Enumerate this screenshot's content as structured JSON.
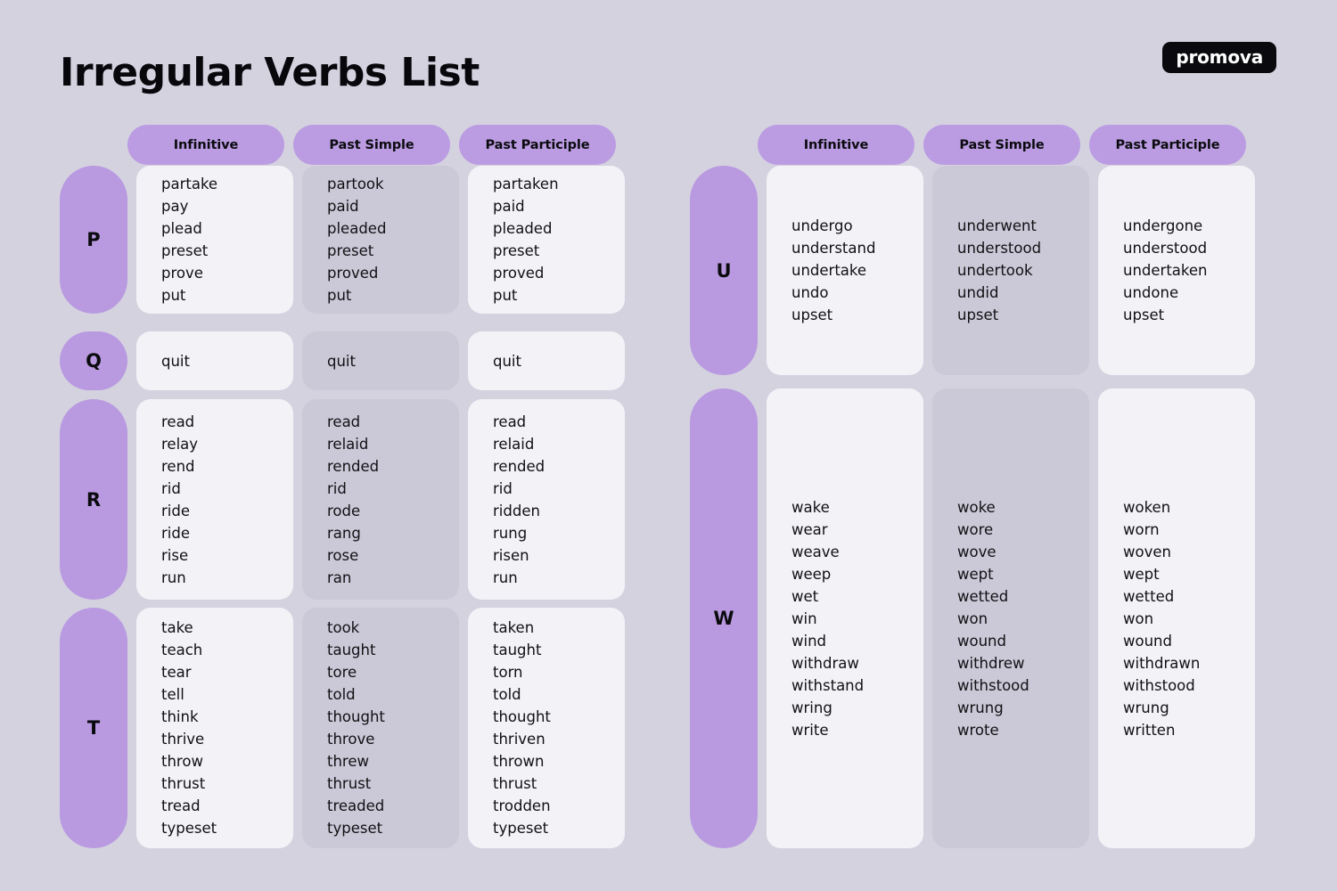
{
  "page": {
    "title": "Irregular Verbs List",
    "brand": "promova",
    "background_color": "#D5D2E0",
    "accent_color": "#BB9CE2",
    "card_light_color": "#F3F2F7",
    "card_shaded_color": "#CBC8D7"
  },
  "columns": {
    "infinitive": "Infinitive",
    "past_simple": "Past Simple",
    "past_participle": "Past Participle"
  },
  "tables": [
    {
      "id": "left",
      "headers": [
        "Infinitive",
        "Past Simple",
        "Past Participle"
      ],
      "groups": [
        {
          "letter": "P",
          "rows": [
            [
              "partake",
              "partook",
              "partaken"
            ],
            [
              "pay",
              "paid",
              "paid"
            ],
            [
              "plead",
              "pleaded",
              "pleaded"
            ],
            [
              "preset",
              "preset",
              "preset"
            ],
            [
              "prove",
              "proved",
              "proved"
            ],
            [
              "put",
              "put",
              "put"
            ]
          ]
        },
        {
          "letter": "Q",
          "rows": [
            [
              "quit",
              "quit",
              "quit"
            ]
          ]
        },
        {
          "letter": "R",
          "rows": [
            [
              "read",
              "read",
              "read"
            ],
            [
              "relay",
              "relaid",
              "relaid"
            ],
            [
              "rend",
              "rended",
              "rended"
            ],
            [
              "rid",
              "rid",
              "rid"
            ],
            [
              "ride",
              "rode",
              "ridden"
            ],
            [
              "ride",
              "rang",
              "rung"
            ],
            [
              "rise",
              "rose",
              "risen"
            ],
            [
              "run",
              "ran",
              "run"
            ]
          ]
        },
        {
          "letter": "T",
          "rows": [
            [
              "take",
              "took",
              "taken"
            ],
            [
              "teach",
              "taught",
              "taught"
            ],
            [
              "tear",
              "tore",
              "torn"
            ],
            [
              "tell",
              "told",
              "told"
            ],
            [
              "think",
              "thought",
              "thought"
            ],
            [
              "thrive",
              "throve",
              "thriven"
            ],
            [
              "throw",
              "threw",
              "thrown"
            ],
            [
              "thrust",
              "thrust",
              "thrust"
            ],
            [
              "tread",
              "treaded",
              "trodden"
            ],
            [
              "typeset",
              "typeset",
              "typeset"
            ]
          ]
        }
      ]
    },
    {
      "id": "right",
      "headers": [
        "Infinitive",
        "Past Simple",
        "Past Participle"
      ],
      "groups": [
        {
          "letter": "U",
          "rows": [
            [
              "undergo",
              "underwent",
              "undergone"
            ],
            [
              "understand",
              "understood",
              "understood"
            ],
            [
              "undertake",
              "undertook",
              "undertaken"
            ],
            [
              "undo",
              "undid",
              "undone"
            ],
            [
              "upset",
              "upset",
              "upset"
            ]
          ]
        },
        {
          "letter": "W",
          "rows": [
            [
              "wake",
              "woke",
              "woken"
            ],
            [
              "wear",
              "wore",
              "worn"
            ],
            [
              "weave",
              "wove",
              "woven"
            ],
            [
              "weep",
              "wept",
              "wept"
            ],
            [
              "wet",
              "wetted",
              "wetted"
            ],
            [
              "win",
              "won",
              "won"
            ],
            [
              "wind",
              "wound",
              "wound"
            ],
            [
              "withdraw",
              "withdrew",
              "withdrawn"
            ],
            [
              "withstand",
              "withstood",
              "withstood"
            ],
            [
              "wring",
              "wrung",
              "wrung"
            ],
            [
              "write",
              "wrote",
              "written"
            ]
          ]
        }
      ]
    }
  ]
}
